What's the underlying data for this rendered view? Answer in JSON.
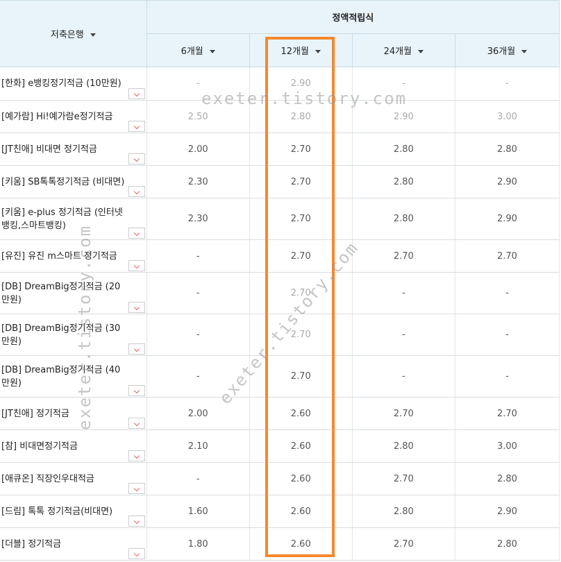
{
  "header": {
    "bank_label": "저축은행",
    "group_label": "정액적립식",
    "terms": [
      "6개월",
      "12개월",
      "24개월",
      "36개월"
    ]
  },
  "rows": [
    {
      "bank": "[한화] e뱅킹정기적금 (10만원)",
      "m6": "-",
      "m12": "2.90",
      "m24": "-",
      "m36": "-"
    },
    {
      "bank": "[예가람] Hi!예가람e정기적금",
      "m6": "2.50",
      "m12": "2.80",
      "m24": "2.90",
      "m36": "3.00"
    },
    {
      "bank": "[JT친애] 비대면 정기적금",
      "m6": "2.00",
      "m12": "2.70",
      "m24": "2.80",
      "m36": "2.80"
    },
    {
      "bank": "[키움] SB톡톡정기적금 (비대면)",
      "m6": "2.30",
      "m12": "2.70",
      "m24": "2.80",
      "m36": "2.90"
    },
    {
      "bank": "[키움] e-plus 정기적금 (인터넷뱅킹,스마트뱅킹)",
      "m6": "2.30",
      "m12": "2.70",
      "m24": "2.80",
      "m36": "2.90"
    },
    {
      "bank": "[유진] 유진 m스마트 정기적금",
      "m6": "-",
      "m12": "2.70",
      "m24": "2.70",
      "m36": "2.70"
    },
    {
      "bank": "[DB] DreamBig정기적금 (20만원)",
      "m6": "-",
      "m12": "2.70",
      "m24": "-",
      "m36": "-"
    },
    {
      "bank": "[DB] DreamBig정기적금 (30만원)",
      "m6": "-",
      "m12": "2.70",
      "m24": "-",
      "m36": "-"
    },
    {
      "bank": "[DB] DreamBig정기적금 (40만원)",
      "m6": "-",
      "m12": "2.70",
      "m24": "-",
      "m36": "-"
    },
    {
      "bank": "[JT친애] 정기적금",
      "m6": "2.00",
      "m12": "2.60",
      "m24": "2.70",
      "m36": "2.70"
    },
    {
      "bank": "[참] 비대면정기적금",
      "m6": "2.10",
      "m12": "2.60",
      "m24": "2.80",
      "m36": "3.00"
    },
    {
      "bank": "[애큐온] 직장인우대적금",
      "m6": "-",
      "m12": "2.60",
      "m24": "2.70",
      "m36": "2.80"
    },
    {
      "bank": "[드림] 톡톡 정기적금(비대면)",
      "m6": "1.60",
      "m12": "2.60",
      "m24": "2.80",
      "m36": "2.90"
    },
    {
      "bank": "[더블] 정기적금",
      "m6": "1.80",
      "m12": "2.60",
      "m24": "2.70",
      "m36": "2.80"
    }
  ],
  "watermark": "exeter.tistory.com",
  "colors": {
    "highlight": "#f5882e",
    "header_bg": "#e9f4fa"
  }
}
